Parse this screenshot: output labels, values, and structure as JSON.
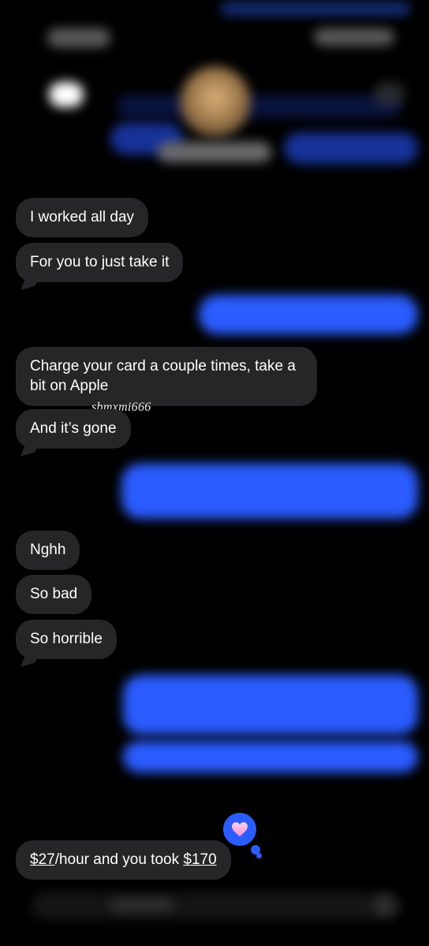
{
  "messages": [
    {
      "text": "I worked all day"
    },
    {
      "text": "For you to just take it"
    },
    {
      "text": "Charge your card a couple times, take a bit on Apple"
    },
    {
      "text": "And it’s gone"
    },
    {
      "text": "Nghh"
    },
    {
      "text": "So bad"
    },
    {
      "text": "So horrible"
    }
  ],
  "last_message": {
    "amount_rate": "$27",
    "middle": "/hour and you took ",
    "amount_taken": "$170"
  },
  "watermark": "sbmxmi666",
  "reaction": {
    "icon": "heart-icon",
    "color": "#f4a7d9",
    "bubble_color": "#2a5cff"
  },
  "colors": {
    "received_bubble": "#262628",
    "sent_bubble": "#2a5cff",
    "background": "#000000"
  }
}
